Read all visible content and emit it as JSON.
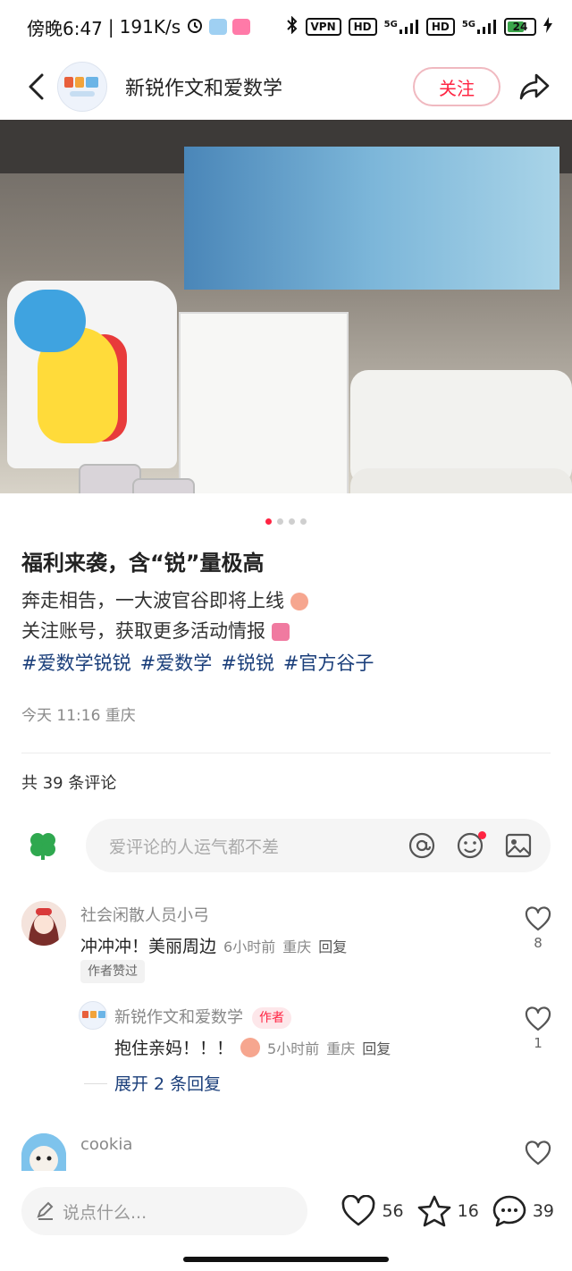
{
  "status_bar": {
    "time": "傍晚6:47",
    "speed": "191K/s",
    "vpn": "VPN",
    "hd1": "HD",
    "hd2": "HD",
    "net1": "5G",
    "net2": "5G",
    "battery": "24"
  },
  "header": {
    "author_name": "新锐作文和爱数学",
    "follow_label": "关注"
  },
  "carousel": {
    "page_count": 4,
    "active_index": 0
  },
  "post": {
    "title": "福利来袭，含“锐”量极高",
    "line1": "奔走相告，一大波官谷即将上线",
    "line2": "关注账号，获取更多活动情报",
    "hashtags": [
      "#爱数学锐锐",
      "#爱数学",
      "#锐锐",
      "#官方谷子"
    ],
    "meta": "今天 11:16 重庆"
  },
  "comments_section": {
    "count_label": "共 39 条评论",
    "input_placeholder": "爱评论的人运气都不差"
  },
  "comments": [
    {
      "user": "社会闲散人员小弓",
      "text": "冲冲冲！美丽周边",
      "time": "6小时前",
      "location": "重庆",
      "reply_label": "回复",
      "liked_badge": "作者赞过",
      "likes": "8"
    },
    {
      "user": "新锐作文和爱数学",
      "author_tag": "作者",
      "text": "抱住亲妈！！！",
      "time": "5小时前",
      "location": "重庆",
      "reply_label": "回复",
      "likes": "1"
    },
    {
      "expand_label": "展开 2 条回复"
    },
    {
      "user": "cookia"
    }
  ],
  "bottom_bar": {
    "input_placeholder": "说点什么...",
    "likes": "56",
    "favorites": "16",
    "comments": "39"
  },
  "colors": {
    "accent": "#ff2442",
    "hashtag": "#1a3e7a",
    "muted": "#8a8a8a"
  }
}
